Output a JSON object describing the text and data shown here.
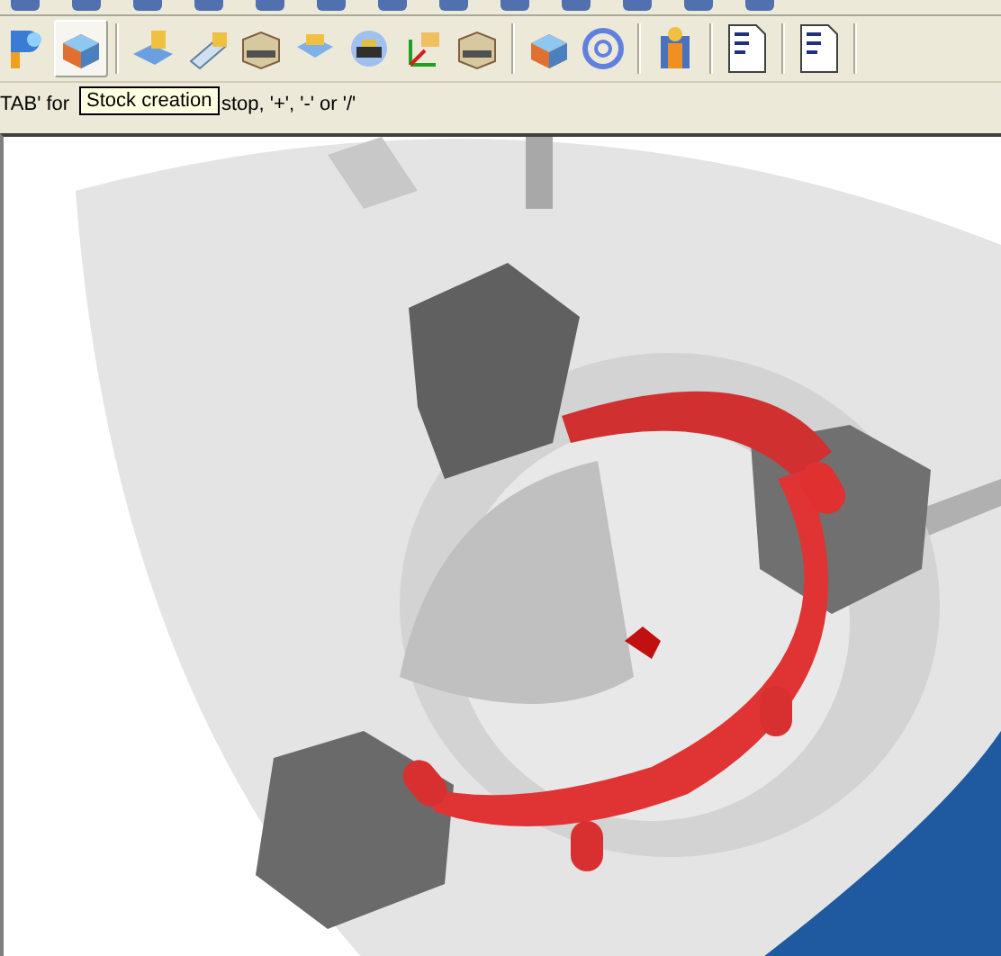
{
  "toolbar": {
    "buttons": [
      {
        "kind": "part",
        "selected": false
      },
      {
        "kind": "stock",
        "selected": true
      },
      {
        "kind": "sep"
      },
      {
        "kind": "rough",
        "selected": false
      },
      {
        "kind": "drill",
        "selected": false
      },
      {
        "kind": "block",
        "selected": false
      },
      {
        "kind": "pocket",
        "selected": false
      },
      {
        "kind": "tool",
        "selected": false
      },
      {
        "kind": "axes",
        "selected": false
      },
      {
        "kind": "block",
        "selected": false
      },
      {
        "kind": "sep"
      },
      {
        "kind": "stock",
        "selected": false
      },
      {
        "kind": "ring",
        "selected": false
      },
      {
        "kind": "sep"
      },
      {
        "kind": "person",
        "selected": false
      },
      {
        "kind": "sep"
      },
      {
        "kind": "nc",
        "selected": false
      },
      {
        "kind": "sep"
      },
      {
        "kind": "nc",
        "selected": false
      },
      {
        "kind": "sep"
      }
    ]
  },
  "tooltip": {
    "text": "Stock creation"
  },
  "status": {
    "parts": [
      "TAB' for",
      "stop, '+', '-' or '/'"
    ]
  }
}
